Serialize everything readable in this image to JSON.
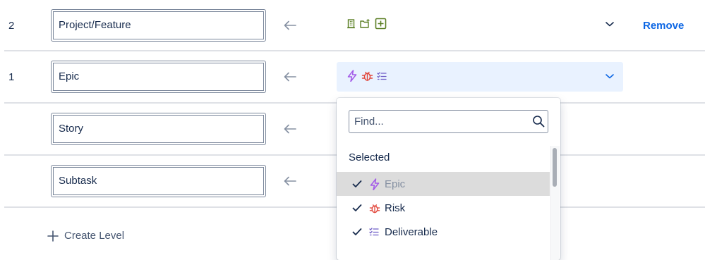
{
  "levels": [
    {
      "number": "2",
      "name": "Project/Feature",
      "issue_type_icons": [
        "building-icon",
        "folder-icon",
        "plus-box-icon"
      ],
      "remove_label": "Remove"
    },
    {
      "number": "1",
      "name": "Epic",
      "issue_type_icons": [
        "lightning-icon",
        "bug-icon",
        "checklist-icon"
      ]
    },
    {
      "number": "",
      "name": "Story"
    },
    {
      "number": "",
      "name": "Subtask"
    }
  ],
  "create_level_label": "Create Level",
  "dropdown": {
    "search_placeholder": "Find...",
    "group_heading": "Selected",
    "options": [
      {
        "label": "Epic",
        "icon": "lightning-icon",
        "checked": true,
        "disabled": true,
        "highlighted": true
      },
      {
        "label": "Risk",
        "icon": "bug-icon",
        "checked": true
      },
      {
        "label": "Deliverable",
        "icon": "checklist-icon",
        "checked": true
      }
    ]
  },
  "colors": {
    "link": "#0c66e4",
    "select_active_bg": "#e9f2ff",
    "epic_purple": "#a35ae8",
    "risk_red": "#e2483d",
    "deliverable_purple": "#6e5dc6",
    "project_green": "#5b7f24"
  }
}
